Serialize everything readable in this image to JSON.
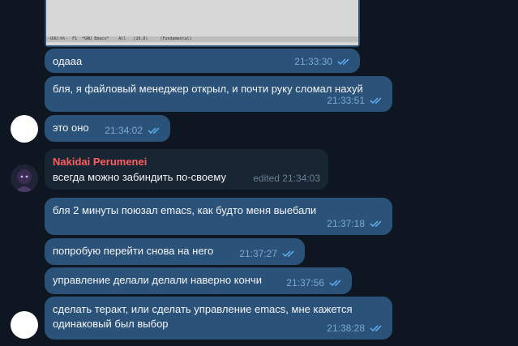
{
  "screenshot": {
    "modeline_text": "-UUU:%%-  F1  *GNU Emacs*    All   (20,0)     (Fundamental)"
  },
  "messages": [
    {
      "text": "одааа",
      "time": "21:33:30"
    },
    {
      "text": "бля, я файловый менеджер открыл, и почти руку сломал нахуй",
      "time": "21:33:51"
    },
    {
      "text": "это оно",
      "time": "21:34:02"
    },
    {
      "sender": "Nakidai Perumenei",
      "text": "всегда можно забиндить по-своему",
      "time": "edited 21:34:03"
    },
    {
      "text": "бля 2 минуты поюзал emacs, как будто меня выебали",
      "time": "21:37:18"
    },
    {
      "text": "попробую перейти снова на него",
      "time": "21:37:27"
    },
    {
      "text": "управление делали делали наверно кончи",
      "time": "21:37:56"
    },
    {
      "text": "сделать теракт, или сделать управление emacs, мне кажется\nодинаковый был выбор",
      "time": "21:38:28"
    }
  ],
  "colors": {
    "background": "#0e1621",
    "outgoing": "#2b5278",
    "incoming": "#182533",
    "sender_name": "#ff5d5d",
    "checks": "#5fb0f0"
  }
}
